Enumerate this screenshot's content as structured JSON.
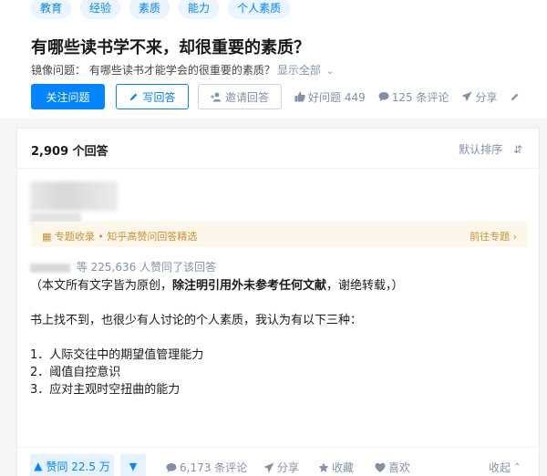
{
  "topics": [
    "教育",
    "经验",
    "素质",
    "能力",
    "个人素质"
  ],
  "question": {
    "title": "有哪些读书学不来，却很重要的素质？",
    "mirror_label": "镜像问题：",
    "mirror_text": "有哪些读书才能学会的很重要的素质？",
    "show_all": "显示全部"
  },
  "actions": {
    "follow": "关注问题",
    "write": "写回答",
    "invite": "邀请回答",
    "good_question": "好问题 449",
    "comments": "125 条评论",
    "share": "分享"
  },
  "answers": {
    "count": "2,909 个回答",
    "sort": "默认排序"
  },
  "collection": {
    "label": "专题收录 • 知乎高赞问回答精选",
    "link": "前往专题"
  },
  "answer": {
    "votes_text": "等 225,636 人赞同了该回答",
    "line1_a": "（本文所有文字皆为原创，",
    "line1_b": "除注明引用外未参考任何文献",
    "line1_c": "，谢绝转载，）",
    "line2": "书上找不到，也很少有人讨论的个人素质，我认为有以下三种：",
    "item1": "1．人际交往中的期望值管理能力",
    "item2": "2．阈值自控意识",
    "item3": "3．应对主观时空扭曲的能力"
  },
  "footer": {
    "upvote": "赞同 22.5 万",
    "comments": "6,173 条评论",
    "share": "分享",
    "collect": "收藏",
    "like": "喜欢",
    "collapse": "收起"
  },
  "colors": {
    "accent": "#0084ff",
    "muted": "#8590a6",
    "gold": "#c7932e"
  }
}
